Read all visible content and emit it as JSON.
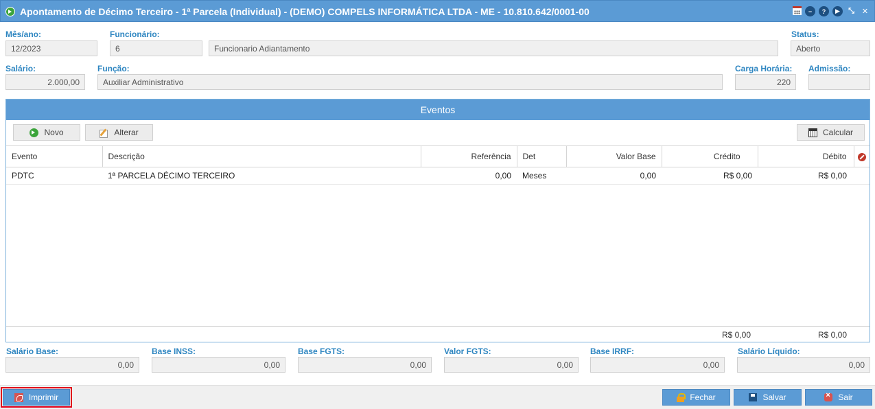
{
  "window": {
    "title": "Apontamento de Décimo Terceiro - 1ª Parcela (Individual) - (DEMO) COMPELS INFORMÁTICA LTDA - ME - 10.810.642/0001-00",
    "actions": [
      "calendar-icon",
      "minimize-icon",
      "help-icon",
      "play-icon",
      "restore-icon",
      "close-icon"
    ]
  },
  "header": {
    "mes_ano": {
      "label": "Mês/ano:",
      "value": "12/2023"
    },
    "funcionario": {
      "label": "Funcionário:",
      "code": "6",
      "name": "Funcionario Adiantamento"
    },
    "status": {
      "label": "Status:",
      "value": "Aberto"
    },
    "salario": {
      "label": "Salário:",
      "value": "2.000,00"
    },
    "funcao": {
      "label": "Função:",
      "value": "Auxiliar Administrativo"
    },
    "carga_horaria": {
      "label": "Carga Horária:",
      "value": "220"
    },
    "admissao": {
      "label": "Admissão:",
      "value": ""
    }
  },
  "eventos": {
    "title": "Eventos",
    "toolbar": {
      "novo": "Novo",
      "alterar": "Alterar",
      "calcular": "Calcular"
    },
    "columns": [
      "Evento",
      "Descrição",
      "Referência",
      "Det",
      "Valor Base",
      "Crédito",
      "Débito"
    ],
    "rows": [
      {
        "evento": "PDTC",
        "descricao": "1ª PARCELA DÉCIMO TERCEIRO",
        "referencia": "0,00",
        "det": "Meses",
        "valor_base": "0,00",
        "credito": "R$ 0,00",
        "debito": "R$ 0,00"
      }
    ],
    "totals": {
      "credito": "R$ 0,00",
      "debito": "R$ 0,00"
    }
  },
  "summary": {
    "salario_base": {
      "label": "Salário Base:",
      "value": "0,00"
    },
    "base_inss": {
      "label": "Base INSS:",
      "value": "0,00"
    },
    "base_fgts": {
      "label": "Base FGTS:",
      "value": "0,00"
    },
    "valor_fgts": {
      "label": "Valor FGTS:",
      "value": "0,00"
    },
    "base_irrf": {
      "label": "Base IRRF:",
      "value": "0,00"
    },
    "salario_liquido": {
      "label": "Salário Líquido:",
      "value": "0,00"
    }
  },
  "footer": {
    "imprimir": "Imprimir",
    "fechar": "Fechar",
    "salvar": "Salvar",
    "sair": "Sair"
  },
  "colors": {
    "accent": "#5b9bd5",
    "label": "#2e86c1",
    "highlight": "#e0001a"
  }
}
